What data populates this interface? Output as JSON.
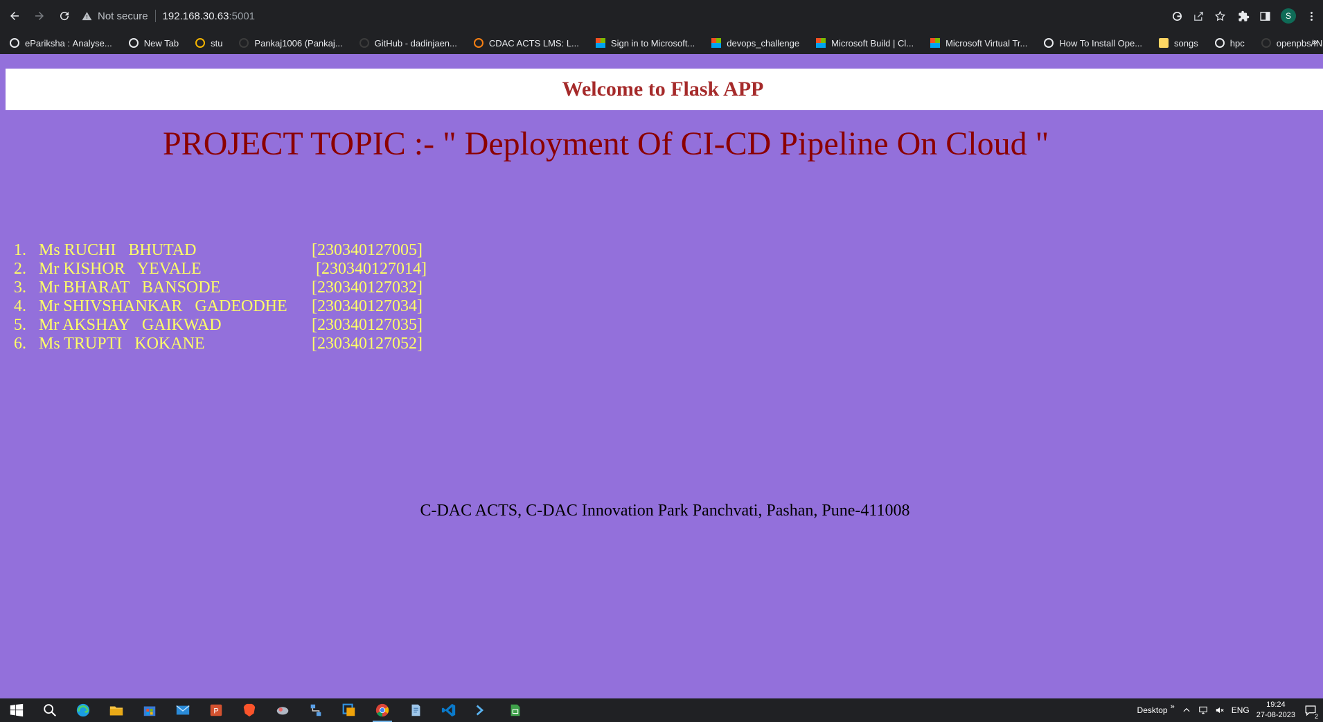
{
  "browser": {
    "security_label": "Not secure",
    "url_host": "192.168.30.63",
    "url_port": ":5001",
    "avatar_letter": "S"
  },
  "bookmarks": [
    {
      "label": "eParikshа : Analyse...",
      "icon": "globe-icon"
    },
    {
      "label": "New Tab",
      "icon": "chrome-icon"
    },
    {
      "label": "stu",
      "icon": "drive-icon"
    },
    {
      "label": "Pankaj1006 (Pankaj...",
      "icon": "github-icon"
    },
    {
      "label": "GitHub - dadinjaen...",
      "icon": "github-icon"
    },
    {
      "label": "CDAC ACTS LMS: L...",
      "icon": "moodle-icon"
    },
    {
      "label": "Sign in to Microsoft...",
      "icon": "microsoft-icon"
    },
    {
      "label": "devops_challenge",
      "icon": "microsoft-icon"
    },
    {
      "label": "Microsoft Build | Cl...",
      "icon": "microsoft-icon"
    },
    {
      "label": "Microsoft Virtual Tr...",
      "icon": "microsoft-icon"
    },
    {
      "label": "How To Install Ope...",
      "icon": "site-icon"
    },
    {
      "label": "songs",
      "icon": "folder-icon"
    },
    {
      "label": "hpc",
      "icon": "image-icon"
    },
    {
      "label": "openpbs/INSTALL a...",
      "icon": "github-icon"
    }
  ],
  "page": {
    "header": "Welcome to Flask APP",
    "topic": "PROJECT TOPIC :- \" Deployment Of CI-CD Pipeline On Cloud \"",
    "members": [
      {
        "num": "1.",
        "name": "Ms RUCHI   BHUTAD",
        "id": "[230340127005]"
      },
      {
        "num": "2.",
        "name": "Mr KISHOR   YEVALE",
        "id": " [230340127014]"
      },
      {
        "num": "3.",
        "name": "Mr BHARAT   BANSODE",
        "id": "[230340127032]"
      },
      {
        "num": "4.",
        "name": "Mr SHIVSHANKAR   GADEODHE",
        "id": "[230340127034]"
      },
      {
        "num": "5.",
        "name": "Mr AKSHAY   GAIKWAD",
        "id": "[230340127035]"
      },
      {
        "num": "6.",
        "name": "Ms TRUPTI   KOKANE",
        "id": "[230340127052]"
      }
    ],
    "address": "C-DAC ACTS, C-DAC Innovation Park Panchvati, Pashan, Pune-411008"
  },
  "taskbar": {
    "desktop_label": "Desktop",
    "lang": "ENG",
    "time": "19:24",
    "date": "27-08-2023",
    "notification_count": "2"
  },
  "colors": {
    "page_bg": "#9370db",
    "header_text": "#a52a2a",
    "topic_text": "#8b0000",
    "member_text": "#ffff66"
  }
}
